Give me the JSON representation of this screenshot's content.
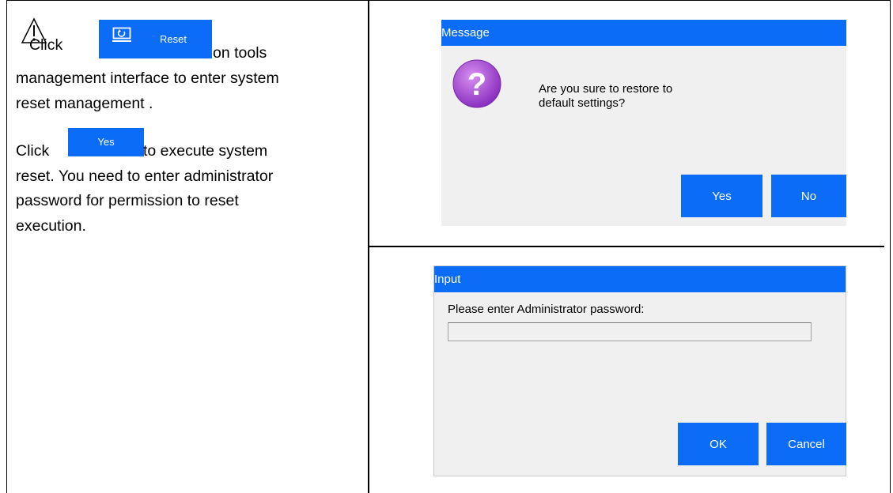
{
  "instructions": {
    "step1": {
      "prefix": "Click",
      "button_label": "Reset",
      "suffix": "on tools",
      "line2": "management interface to enter system",
      "line3": "reset management ."
    },
    "step2": {
      "prefix": "Click",
      "button_label": "Yes",
      "suffix": "to execute system",
      "line2": "reset. You need to enter administrator",
      "line3": "password for permission to reset",
      "line4": "execution."
    }
  },
  "message_dialog": {
    "title": "Message",
    "text_line1": "Are you sure to restore to",
    "text_line2": "default settings?",
    "yes_label": "Yes",
    "no_label": "No"
  },
  "input_dialog": {
    "title": "Input",
    "prompt": "Please enter Administrator password:",
    "password_value": "",
    "ok_label": "OK",
    "cancel_label": "Cancel"
  },
  "colors": {
    "accent": "#0a6cf7",
    "dialog_bg": "#f0f0f0",
    "question_icon": "#a040d0"
  },
  "icons": [
    "warning-icon",
    "reset-icon",
    "question-icon"
  ]
}
